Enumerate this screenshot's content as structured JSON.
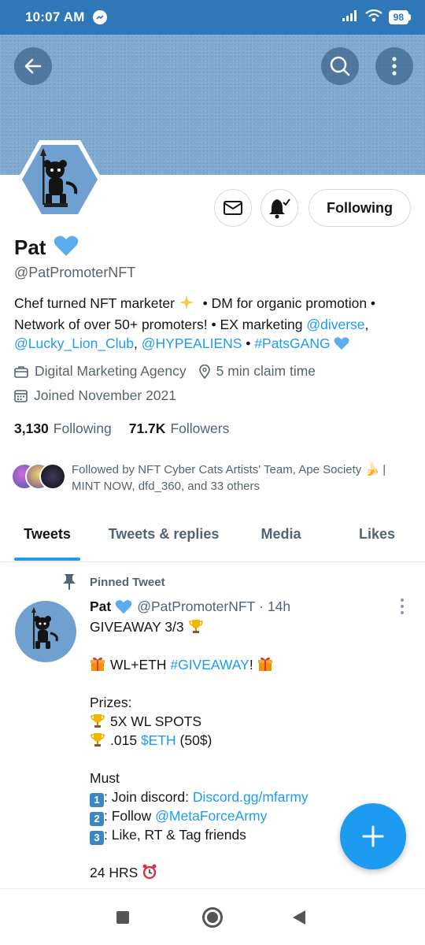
{
  "status_bar": {
    "time": "10:07 AM",
    "battery": "98"
  },
  "header": {
    "back_icon": "arrow-left-icon",
    "search_icon": "search-icon",
    "more_icon": "more-vertical-icon",
    "banner_color": "#7ea9d1"
  },
  "profile": {
    "name": "Pat",
    "handle": "@PatPromoterNFT",
    "bio": {
      "line1_a": "Chef turned NFT marketer ",
      "line1_b": " • DM for organic promotion •",
      "line2_a": "Network of over 50+ promoters! • EX marketing ",
      "line2_mention": "@diverse",
      "line2_b": ",",
      "line3_m1": "@Lucky_Lion_Club",
      "line3_sep": ", ",
      "line3_m2": "@HYPEALIENS",
      "line3_dot": " • ",
      "line3_tag": "#PatsGANG"
    },
    "category": "Digital Marketing Agency",
    "location": "5 min claim time",
    "joined": "Joined November 2021",
    "following_count": "3,130",
    "following_label": "Following",
    "followers_count": "71.7K",
    "followers_label": "Followers",
    "followed_by": "Followed by NFT Cyber Cats Artists' Team, Ape Society 🍌 | MINT NOW, dfd_360, and 33 others"
  },
  "actions": {
    "following_button": "Following"
  },
  "tabs": [
    {
      "label": "Tweets"
    },
    {
      "label": "Tweets & replies"
    },
    {
      "label": "Media"
    },
    {
      "label": "Likes"
    }
  ],
  "tweet": {
    "pinned_label": "Pinned Tweet",
    "name": "Pat",
    "handle": "@PatPromoterNFT",
    "time": "· 14h",
    "lines": {
      "l1": "GIVEAWAY 3/3",
      "l2_a": "WL+ETH ",
      "l2_tag": "#GIVEAWAY",
      "l2_b": "!",
      "l3": "Prizes:",
      "l4": "5X WL SPOTS",
      "l5_a": ".015 ",
      "l5_tag": "$ETH",
      "l5_b": " (50$)",
      "l6": "Must",
      "l7_key": "1",
      "l7_a": ": Join discord: ",
      "l7_link": "Discord.gg/mfarmy",
      "l8_key": "2",
      "l8_a": ": Follow ",
      "l8_link": "@MetaForceArmy",
      "l9_key": "3",
      "l9_a": ": Like, RT & Tag friends",
      "l10": "24 HRS"
    }
  },
  "colors": {
    "accent": "#1d9bf0",
    "status_bar": "#2e77b8",
    "text_secondary": "#536471"
  }
}
